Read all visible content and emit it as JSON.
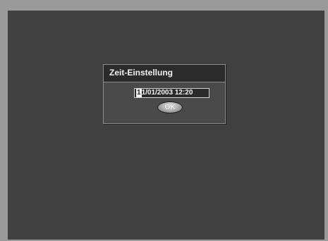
{
  "dialog": {
    "title": "Zeit-Einstellung",
    "datetime": {
      "cursor_char": "1",
      "rest": "1/01/2003  12:20"
    },
    "ok_label": "OK"
  }
}
